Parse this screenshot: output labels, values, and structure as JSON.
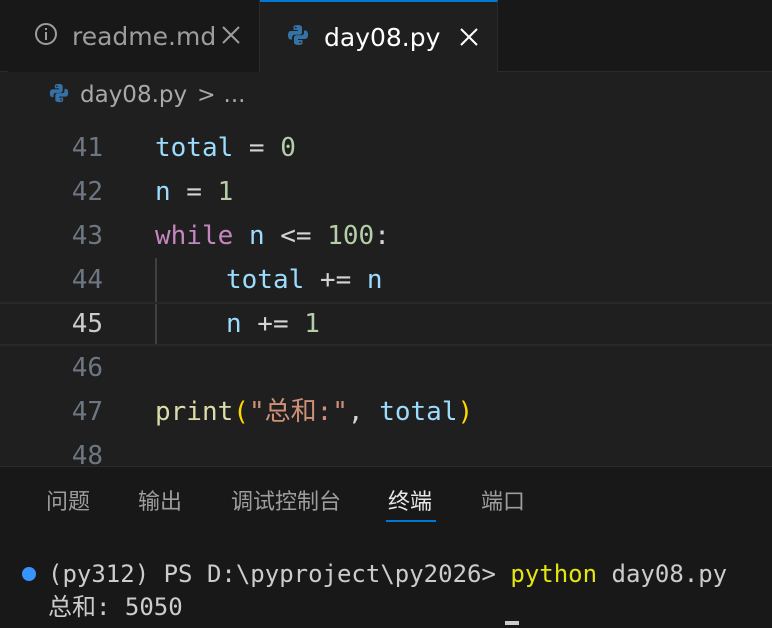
{
  "tabs": [
    {
      "label": "readme.md",
      "icon": "info-icon",
      "active": false
    },
    {
      "label": "day08.py",
      "icon": "python-icon",
      "active": true
    }
  ],
  "breadcrumb": {
    "file": "day08.py",
    "separator": ">",
    "ellipsis": "..."
  },
  "editor": {
    "lines": [
      {
        "num": "41",
        "tokens": [
          "total",
          " = ",
          "0"
        ]
      },
      {
        "num": "42",
        "tokens": [
          "n",
          " = ",
          "1"
        ]
      },
      {
        "num": "43",
        "tokens": [
          "while",
          " ",
          "n",
          " <= ",
          "100",
          ":"
        ]
      },
      {
        "num": "44",
        "tokens": [
          "total",
          " += ",
          "n"
        ]
      },
      {
        "num": "45",
        "tokens": [
          "n",
          " += ",
          "1"
        ]
      },
      {
        "num": "46",
        "tokens": []
      },
      {
        "num": "47",
        "tokens": [
          "print",
          "(",
          "\"总和:\"",
          ", ",
          "total",
          ")"
        ]
      },
      {
        "num": "48",
        "tokens": []
      }
    ],
    "active_line": "45"
  },
  "panel": {
    "tabs": [
      "问题",
      "输出",
      "调试控制台",
      "终端",
      "端口"
    ],
    "active_tab": "终端"
  },
  "terminal": {
    "prompt": "(py312) PS D:\\pyproject\\py2026> ",
    "command": "python",
    "argument": " day08.py",
    "output": "总和: 5050"
  },
  "colors": {
    "accent": "#0078d4",
    "python_icon": "#3572a5",
    "terminal_status_dot": "#3794ff"
  }
}
